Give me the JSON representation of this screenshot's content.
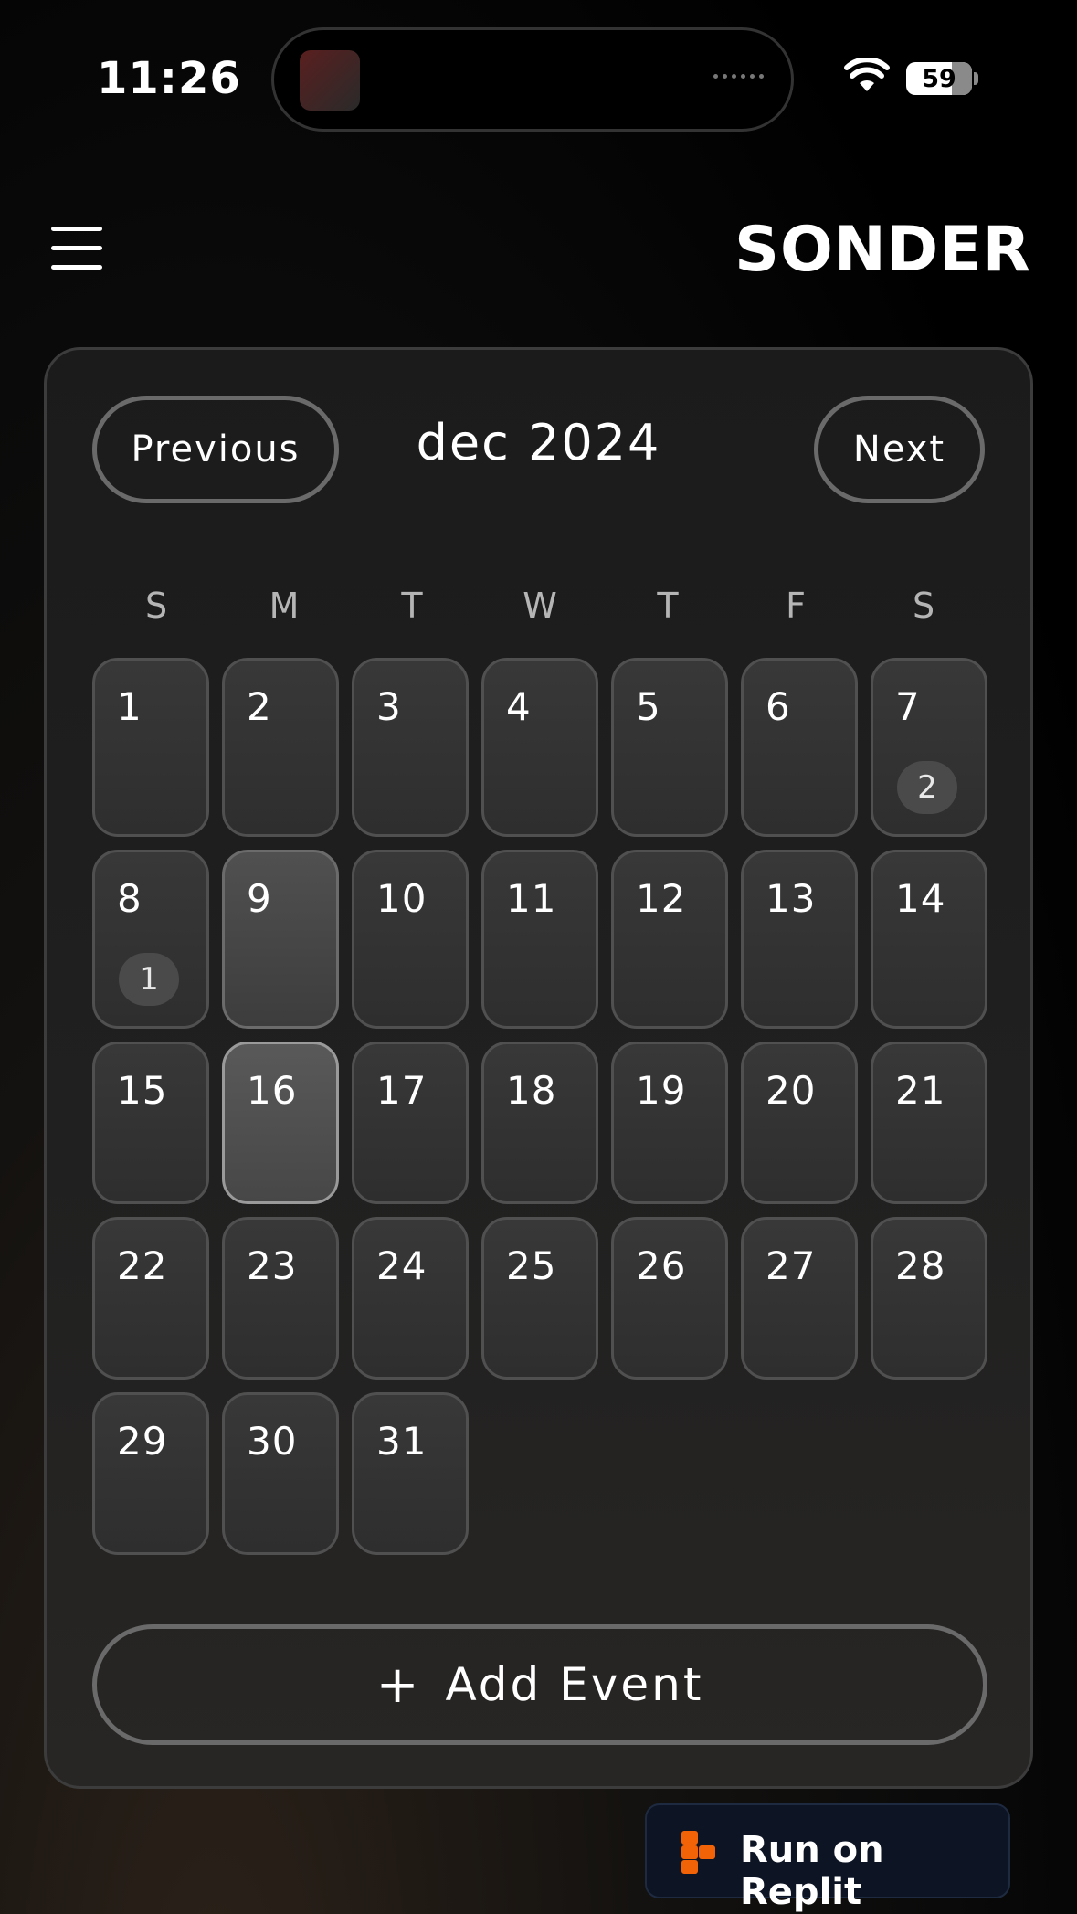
{
  "status_bar": {
    "time": "11:26",
    "battery": "59"
  },
  "header": {
    "brand": "SONDER"
  },
  "calendar": {
    "prev_label": "Previous",
    "next_label": "Next",
    "month_label": "dec 2024",
    "weekdays": [
      "S",
      "M",
      "T",
      "W",
      "T",
      "F",
      "S"
    ],
    "days": [
      {
        "n": "1"
      },
      {
        "n": "2"
      },
      {
        "n": "3"
      },
      {
        "n": "4"
      },
      {
        "n": "5"
      },
      {
        "n": "6"
      },
      {
        "n": "7",
        "badge": "2"
      },
      {
        "n": "8",
        "badge": "1"
      },
      {
        "n": "9",
        "state": "today"
      },
      {
        "n": "10"
      },
      {
        "n": "11"
      },
      {
        "n": "12"
      },
      {
        "n": "13"
      },
      {
        "n": "14"
      },
      {
        "n": "15"
      },
      {
        "n": "16",
        "state": "selected"
      },
      {
        "n": "17"
      },
      {
        "n": "18"
      },
      {
        "n": "19"
      },
      {
        "n": "20"
      },
      {
        "n": "21"
      },
      {
        "n": "22"
      },
      {
        "n": "23"
      },
      {
        "n": "24"
      },
      {
        "n": "25"
      },
      {
        "n": "26"
      },
      {
        "n": "27"
      },
      {
        "n": "28"
      },
      {
        "n": "29"
      },
      {
        "n": "30"
      },
      {
        "n": "31"
      }
    ],
    "add_event_label": "Add Event"
  },
  "replit": {
    "label": "Run on Replit"
  },
  "colors": {
    "accent_replit": "#f26207",
    "background": "#000000"
  }
}
